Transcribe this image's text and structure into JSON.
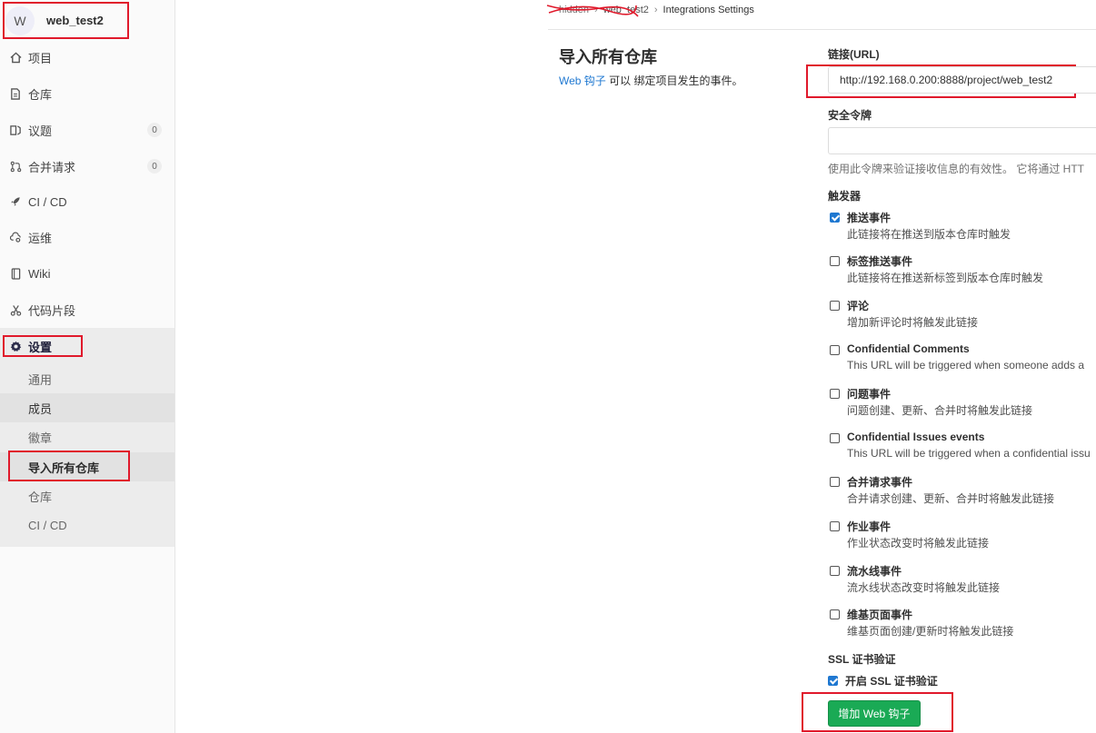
{
  "sidebar": {
    "project_initial": "W",
    "project_name": "web_test2",
    "items": [
      {
        "label": "项目",
        "icon": "home-icon"
      },
      {
        "label": "仓库",
        "icon": "file-icon"
      },
      {
        "label": "议题",
        "icon": "issues-icon",
        "badge": "0"
      },
      {
        "label": "合并请求",
        "icon": "merge-request-icon",
        "badge": "0"
      },
      {
        "label": "CI / CD",
        "icon": "rocket-icon"
      },
      {
        "label": "运维",
        "icon": "cloud-gear-icon"
      },
      {
        "label": "Wiki",
        "icon": "book-icon"
      },
      {
        "label": "代码片段",
        "icon": "scissors-icon"
      },
      {
        "label": "设置",
        "icon": "settings-icon"
      }
    ],
    "sub_items": [
      "通用",
      "成员",
      "徽章",
      "导入所有仓库",
      "仓库",
      "CI / CD"
    ]
  },
  "breadcrumb": {
    "group": "hidden",
    "project": "web_test2",
    "current": "Integrations Settings"
  },
  "page": {
    "title": "导入所有仓库",
    "desc_link": "Web 钩子",
    "desc_text": " 可以 绑定项目发生的事件。"
  },
  "form": {
    "url_label": "链接(URL)",
    "url_value": "http://192.168.0.200:8888/project/web_test2",
    "token_label": "安全令牌",
    "token_value": "",
    "token_help": "使用此令牌来验证接收信息的有效性。 它将通过 HTT",
    "triggers_label": "触发器",
    "triggers": [
      {
        "title": "推送事件",
        "desc": "此链接将在推送到版本仓库时触发",
        "checked": true
      },
      {
        "title": "标签推送事件",
        "desc": "此链接将在推送新标签到版本仓库时触发",
        "checked": false
      },
      {
        "title": "评论",
        "desc": "增加新评论时将触发此链接",
        "checked": false
      },
      {
        "title": "Confidential Comments",
        "desc": "This URL will be triggered when someone adds a",
        "checked": false
      },
      {
        "title": "问题事件",
        "desc": "问题创建、更新、合并时将触发此链接",
        "checked": false
      },
      {
        "title": "Confidential Issues events",
        "desc": "This URL will be triggered when a confidential issu",
        "checked": false
      },
      {
        "title": "合并请求事件",
        "desc": "合并请求创建、更新、合并时将触发此链接",
        "checked": false
      },
      {
        "title": "作业事件",
        "desc": "作业状态改变时将触发此链接",
        "checked": false
      },
      {
        "title": "流水线事件",
        "desc": "流水线状态改变时将触发此链接",
        "checked": false
      },
      {
        "title": "维基页面事件",
        "desc": "维基页面创建/更新时将触发此链接",
        "checked": false
      }
    ],
    "ssl_label": "SSL 证书验证",
    "ssl_option": "开启 SSL 证书验证",
    "ssl_checked": true,
    "submit_label": "增加 Web 钩子"
  },
  "colors": {
    "accent": "#1f78d1",
    "submit": "#1aaa55",
    "annotation": "#e0192b"
  }
}
